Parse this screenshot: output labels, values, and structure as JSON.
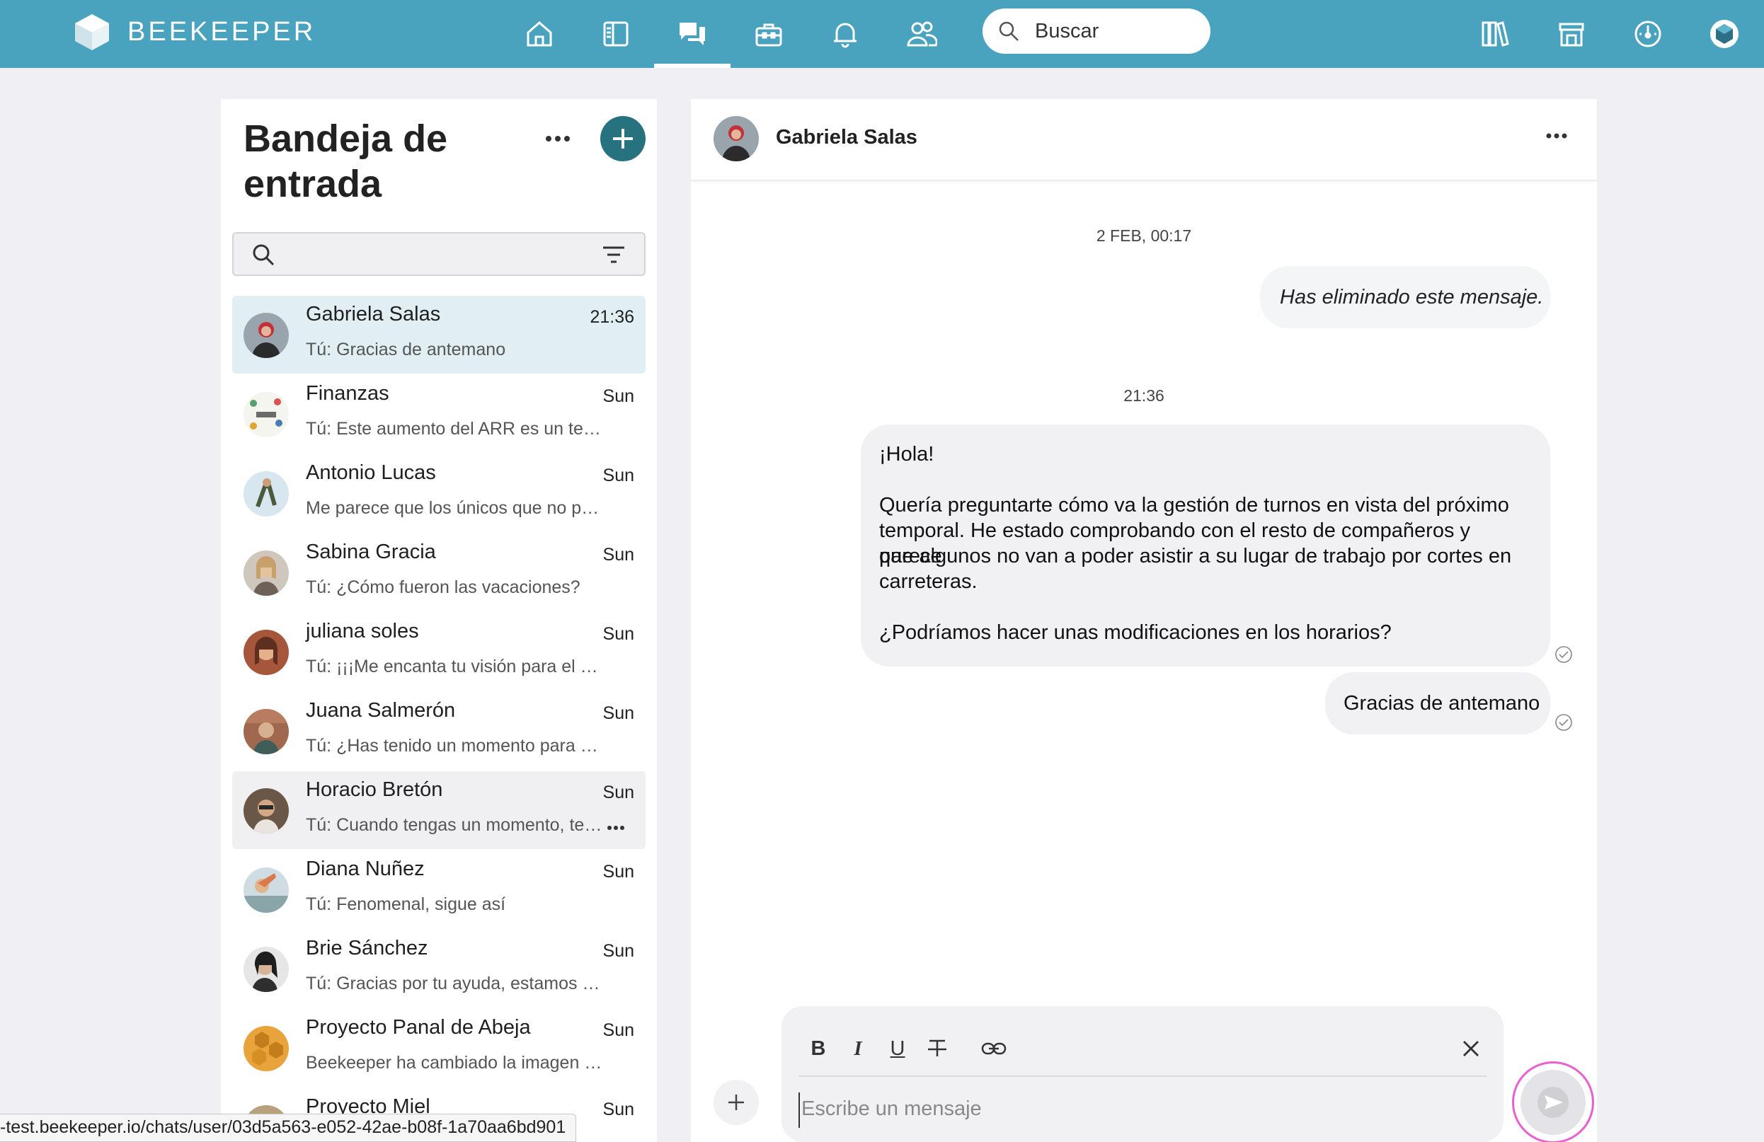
{
  "app": {
    "brand": "BEEKEEPER",
    "search_placeholder": "Buscar"
  },
  "nav": [
    "home-icon",
    "stream-icon",
    "chat-icon",
    "tools-icon",
    "notifications-icon",
    "people-icon"
  ],
  "nav_right": [
    "library-icon",
    "shop-icon",
    "dashboard-icon",
    "profile-icon"
  ],
  "inbox": {
    "title": "Bandeja de entrada",
    "conversations": [
      {
        "name": "Gabriela Salas",
        "time": "21:36",
        "preview": "Tú: Gracias de antemano",
        "state": "active"
      },
      {
        "name": "Finanzas",
        "time": "Sun",
        "preview": "Tú: Este aumento del ARR es un testimonio",
        "state": ""
      },
      {
        "name": "Antonio Lucas",
        "time": "Sun",
        "preview": "Me parece que los únicos que no pueden",
        "state": ""
      },
      {
        "name": "Sabina Gracia",
        "time": "Sun",
        "preview": "Tú: ¿Cómo fueron las vacaciones?",
        "state": ""
      },
      {
        "name": "juliana soles",
        "time": "Sun",
        "preview": "Tú: ¡¡¡Me encanta tu visión para el proyecto",
        "state": ""
      },
      {
        "name": "Juana Salmerón",
        "time": "Sun",
        "preview": "Tú: ¿Has tenido un momento para revisar",
        "state": ""
      },
      {
        "name": "Horacio Bretón",
        "time": "Sun",
        "preview": "Tú: Cuando tengas un momento, te envío",
        "state": "hover"
      },
      {
        "name": "Diana Nuñez",
        "time": "Sun",
        "preview": "Tú: Fenomenal, sigue así",
        "state": ""
      },
      {
        "name": "Brie Sánchez",
        "time": "Sun",
        "preview": "Tú: Gracias por tu ayuda, estamos en ello",
        "state": ""
      },
      {
        "name": "Proyecto Panal de Abeja",
        "time": "Sun",
        "preview": "Beekeeper ha cambiado la imagen del chat",
        "state": ""
      },
      {
        "name": "Proyecto Miel",
        "time": "Sun",
        "preview": "",
        "state": ""
      }
    ]
  },
  "chat": {
    "contact": "Gabriela Salas",
    "timestamp_1": "2 FEB, 00:17",
    "deleted_message": "Has eliminado este mensaje.",
    "timestamp_2": "21:36",
    "message_1": [
      "¡Hola!",
      "",
      "Quería preguntarte cómo va la gestión de turnos en vista del próximo",
      "temporal. He estado comprobando con el resto de compañeros y parece",
      "que algunos no van a poder asistir a su lugar de trabajo por cortes en",
      "carreteras.",
      "",
      "¿Podríamos hacer unas modificaciones en los horarios?"
    ],
    "message_2": "Gracias de antemano",
    "composer_placeholder": "Escribe un mensaje",
    "format_buttons": [
      "B",
      "I",
      "U"
    ]
  },
  "status_url": "-test.beekeeper.io/chats/user/03d5a563-e052-42ae-b08f-1a70aa6bd901",
  "colors": {
    "topbar": "#4aa3be",
    "accent": "#26727f",
    "active_row": "#e1eff4",
    "send_ring": "#e860d2"
  }
}
